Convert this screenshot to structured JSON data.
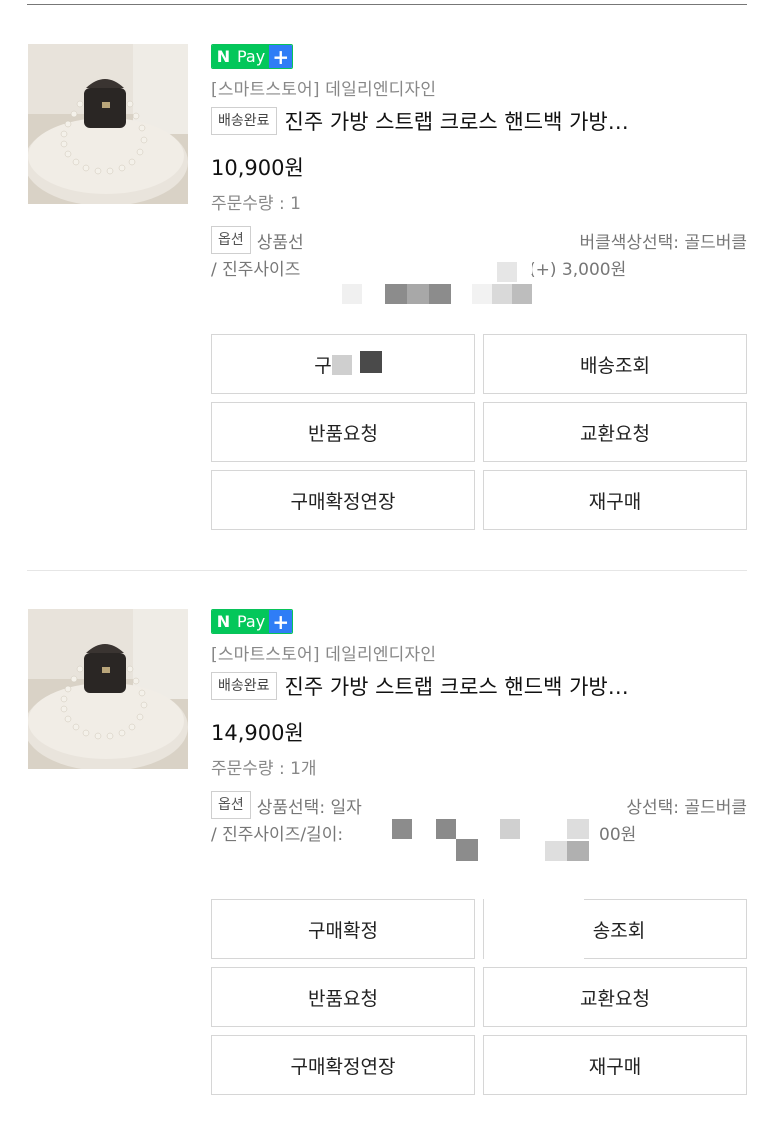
{
  "orders": [
    {
      "npay_label": "Pay",
      "npay_n": "N",
      "npay_plus": "+",
      "store": "[스마트스토어] 데일리엔디자인",
      "status": "배송완료",
      "title": "진주 가방 스트랩 크로스 핸드백 가방…",
      "price": "10,900원",
      "quantity": "주문수량 : 1",
      "option_badge": "옵션",
      "option_line1_left": "상품선",
      "option_line1_right": "버클색상선택: 골드버클",
      "option_line2_left": "/ 진주사이즈",
      "option_line2_right": "(+) 3,000원",
      "buttons": {
        "confirm": "구",
        "tracking": "배송조회",
        "return": "반품요청",
        "exchange": "교환요청",
        "extend": "구매확정연장",
        "rebuy": "재구매"
      }
    },
    {
      "npay_label": "Pay",
      "npay_n": "N",
      "npay_plus": "+",
      "store": "[스마트스토어] 데일리엔디자인",
      "status": "배송완료",
      "title": "진주 가방 스트랩 크로스 핸드백 가방…",
      "price": "14,900원",
      "quantity": "주문수량 : 1개",
      "option_badge": "옵션",
      "option_line1_left": "상품선택: 일자",
      "option_line1_right": "상선택: 골드버클",
      "option_line2_left": "/ 진주사이즈/길이: ",
      "option_line2_right": "00원",
      "buttons": {
        "confirm": "구매확정",
        "tracking": "송조회",
        "return": "반품요청",
        "exchange": "교환요청",
        "extend": "구매확정연장",
        "rebuy": "재구매"
      }
    }
  ],
  "colors": {
    "npay_green": "#03c75a",
    "npay_blue": "#2f7df6",
    "muted_text": "#888888"
  }
}
